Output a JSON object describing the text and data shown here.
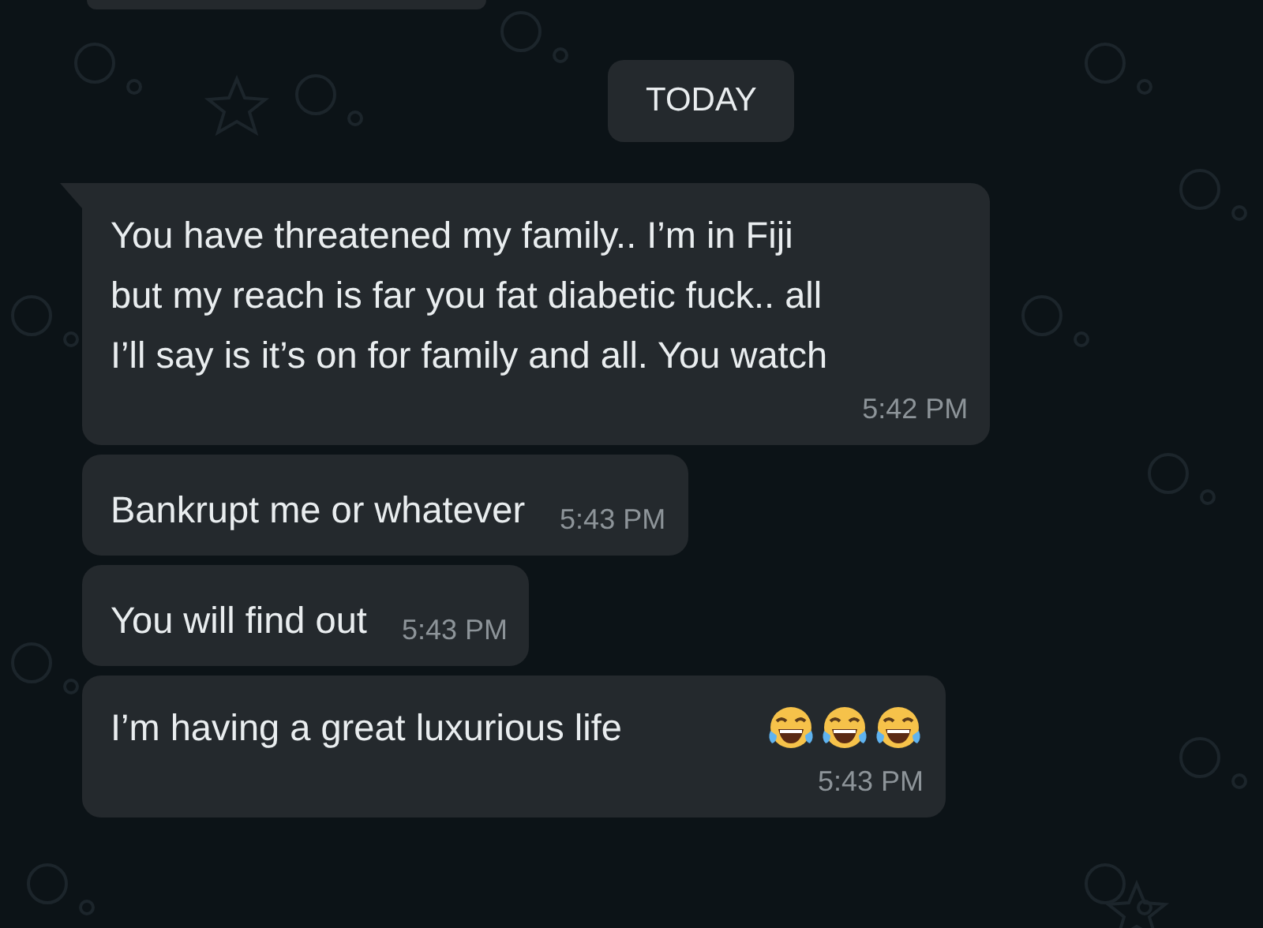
{
  "date_chip": "TODAY",
  "messages": [
    {
      "text": "You have threatened my family.. I’m in Fiji\nbut my reach is far you fat diabetic fuck.. all\nI’ll say is it’s on for family and all. You watch",
      "time": "5:42 PM",
      "tail": true,
      "kind": "stacked"
    },
    {
      "text": "Bankrupt me or whatever",
      "time": "5:43 PM",
      "tail": false,
      "kind": "inline"
    },
    {
      "text": "You will find out",
      "time": "5:43 PM",
      "tail": false,
      "kind": "inline"
    },
    {
      "text": "I’m having a great luxurious life",
      "emojis": [
        {
          "kind": "tears-of-joy"
        },
        {
          "kind": "tears-of-joy"
        },
        {
          "kind": "tears-of-joy"
        }
      ],
      "time": "5:43 PM",
      "tail": false,
      "kind": "stacked"
    }
  ]
}
